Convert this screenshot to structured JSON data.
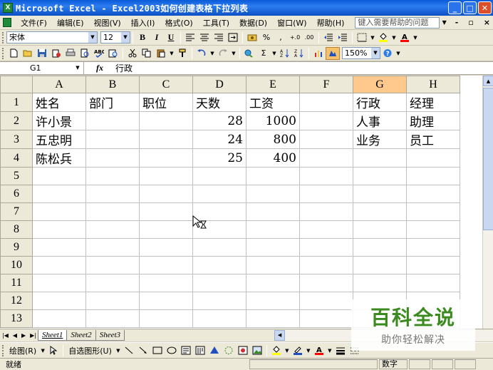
{
  "window": {
    "title": "Microsoft Excel - Excel2003如何创建表格下拉列表",
    "app_icon_label": "X"
  },
  "menu": {
    "items": [
      "文件(F)",
      "编辑(E)",
      "视图(V)",
      "插入(I)",
      "格式(O)",
      "工具(T)",
      "数据(D)",
      "窗口(W)",
      "帮助(H)"
    ],
    "help_placeholder": "键入需要帮助的问题"
  },
  "format_toolbar": {
    "font_name": "宋体",
    "font_size": "12",
    "bold": "B",
    "italic": "I",
    "underline": "U",
    "percent": "%",
    "comma": ",",
    "increase_decimal": "+.0",
    "decrease_decimal": ".00"
  },
  "standard_toolbar": {
    "zoom": "150%",
    "sum": "Σ"
  },
  "formula_bar": {
    "cell_ref": "G1",
    "fx_label": "fx",
    "content": "行政"
  },
  "sheet": {
    "columns": [
      "A",
      "B",
      "C",
      "D",
      "E",
      "F",
      "G",
      "H"
    ],
    "selected_column": "G",
    "rows": [
      {
        "num": "1",
        "cells": [
          "姓名",
          "部门",
          "职位",
          "天数",
          "工资",
          "",
          "行政",
          "经理"
        ]
      },
      {
        "num": "2",
        "cells": [
          "许小景",
          "",
          "",
          "28",
          "1000",
          "",
          "人事",
          "助理"
        ]
      },
      {
        "num": "3",
        "cells": [
          "五忠明",
          "",
          "",
          "24",
          "800",
          "",
          "业务",
          "员工"
        ]
      },
      {
        "num": "4",
        "cells": [
          "陈松兵",
          "",
          "",
          "25",
          "400",
          "",
          "",
          ""
        ]
      },
      {
        "num": "5",
        "cells": [
          "",
          "",
          "",
          "",
          "",
          "",
          "",
          ""
        ]
      },
      {
        "num": "6",
        "cells": [
          "",
          "",
          "",
          "",
          "",
          "",
          "",
          ""
        ]
      },
      {
        "num": "7",
        "cells": [
          "",
          "",
          "",
          "",
          "",
          "",
          "",
          ""
        ]
      },
      {
        "num": "8",
        "cells": [
          "",
          "",
          "",
          "",
          "",
          "",
          "",
          ""
        ]
      },
      {
        "num": "9",
        "cells": [
          "",
          "",
          "",
          "",
          "",
          "",
          "",
          ""
        ]
      },
      {
        "num": "10",
        "cells": [
          "",
          "",
          "",
          "",
          "",
          "",
          "",
          ""
        ]
      },
      {
        "num": "11",
        "cells": [
          "",
          "",
          "",
          "",
          "",
          "",
          "",
          ""
        ]
      },
      {
        "num": "12",
        "cells": [
          "",
          "",
          "",
          "",
          "",
          "",
          "",
          ""
        ]
      },
      {
        "num": "13",
        "cells": [
          "",
          "",
          "",
          "",
          "",
          "",
          "",
          ""
        ]
      }
    ]
  },
  "sheet_tabs": [
    "Sheet1",
    "Sheet2",
    "Sheet3"
  ],
  "drawing_toolbar": {
    "draw_label": "绘图(R)",
    "autoshapes_label": "自选图形(U)"
  },
  "status": {
    "ready": "就绪",
    "num_indicator": "数字"
  },
  "watermark": {
    "main": "百科全说",
    "sub": "助你轻松解决"
  }
}
